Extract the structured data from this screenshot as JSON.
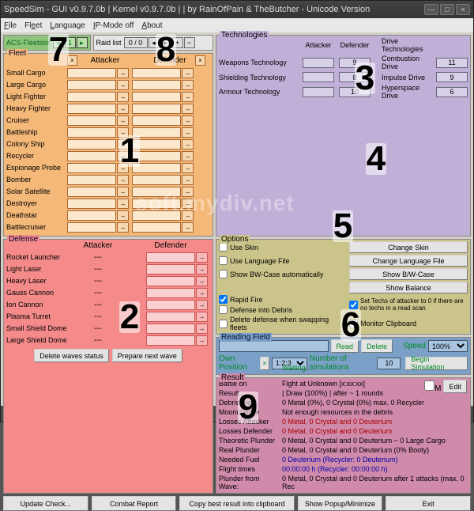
{
  "window": {
    "title": "SpeedSim - GUI v0.9.7.0b  |  Kernel v0.9.7.0b  | |  by RainOfPain & TheButcher - Unicode Version"
  },
  "menu": {
    "file": "File",
    "fleet": "Fleet",
    "language": "Language",
    "ipmode": "IP-Mode off",
    "about": "About"
  },
  "acs": {
    "label": "ACS-Fleetslot",
    "val": "1"
  },
  "raid": {
    "label": "Raid list",
    "val": "0 / 0"
  },
  "fleet": {
    "legend": "Fleet",
    "hdr_att": "Attacker",
    "hdr_def": "Defender",
    "items": [
      {
        "name": "Small Cargo"
      },
      {
        "name": "Large Cargo"
      },
      {
        "name": "Light Fighter"
      },
      {
        "name": "Heavy Fighter"
      },
      {
        "name": "Cruiser"
      },
      {
        "name": "Battleship"
      },
      {
        "name": "Colony Ship"
      },
      {
        "name": "Recycler"
      },
      {
        "name": "Espionage Probe"
      },
      {
        "name": "Bomber"
      },
      {
        "name": "Solar Satellite"
      },
      {
        "name": "Destroyer"
      },
      {
        "name": "Deathstar"
      },
      {
        "name": "Battlecruiser"
      }
    ]
  },
  "defense": {
    "legend": "Defense",
    "hdr_att": "Attacker",
    "hdr_def": "Defender",
    "items": [
      {
        "name": "Rocket Launcher"
      },
      {
        "name": "Light Laser"
      },
      {
        "name": "Heavy Laser"
      },
      {
        "name": "Gauss Cannon"
      },
      {
        "name": "Ion Cannon"
      },
      {
        "name": "Plasma Turret"
      },
      {
        "name": "Small Shield Dome"
      },
      {
        "name": "Large Shield Dome"
      }
    ],
    "btn_delete": "Delete waves status",
    "btn_prepare": "Prepare next wave"
  },
  "tech": {
    "legend": "Technologies",
    "hdr_att": "Attacker",
    "hdr_def": "Defender",
    "hdr_drive": "Drive Technologies",
    "rows": [
      {
        "name": "Weapons Technology",
        "a": "",
        "d": "9",
        "drive": "Combustion Drive",
        "dv": "11"
      },
      {
        "name": "Shielding Technology",
        "a": "",
        "d": "8",
        "drive": "Impulse Drive",
        "dv": "9"
      },
      {
        "name": "Armour Technology",
        "a": "",
        "d": "10",
        "drive": "Hyperspace Drive",
        "dv": "6"
      }
    ]
  },
  "options": {
    "legend": "Options",
    "use_skin": "Use Skin",
    "change_skin": "Change Skin",
    "use_lang": "Use Language File",
    "change_lang": "Change Language File",
    "show_bw": "Show BW-Case automatically",
    "show_bw_btn": "Show B/W-Case",
    "show_balance": "Show Balance",
    "rapid": "Rapid Fire",
    "def_debris": "Defense into Debris",
    "set_techs": "Set Techs of attacker to 0 if there are no techs in a read scan",
    "del_def": "Delete defense when swapping fleets",
    "monitor": "Monitor Clipboard"
  },
  "reading": {
    "legend": "Reading Field",
    "read": "Read",
    "delete": "Delete",
    "speed_lbl": "Speed",
    "speed_val": "100%",
    "ownpos": "Own Position",
    "pos_val": "1:2:3",
    "numsim_lbl": "Number of simulations",
    "numsim_val": "10",
    "waiting": "Waiting...",
    "begin": "Begin Simulation"
  },
  "result": {
    "legend": "Result",
    "m_lbl": "M",
    "edit": "Edit",
    "rows": [
      {
        "k": "Battle on",
        "v": "Fight at Unknown [x:xx:xx]"
      },
      {
        "k": "Result",
        "v": "| Draw (100%) | after ~ 1 rounds"
      },
      {
        "k": "Debris Field",
        "v": "0 Metal (0%), 0 Crystal (0%) max. 0 Recycler"
      },
      {
        "k": "Moonchance",
        "v": "Not enough resources in the debris"
      },
      {
        "k": "Losses Attacker",
        "v": "0 Metal, 0 Crystal and 0 Deuterium",
        "cls": "red"
      },
      {
        "k": "Losses Defender",
        "v": "0 Metal, 0 Crystal and 0 Deuterium",
        "cls": "red"
      },
      {
        "k": "Theoretic Plunder",
        "v": "0 Metal, 0 Crystal and 0 Deuterium ~ 0 Large Cargo"
      },
      {
        "k": "Real Plunder",
        "v": "0 Metal, 0 Crystal and 0 Deuterium (0% Booty)"
      },
      {
        "k": "Needed Fuel",
        "v": "0 Deuterium (Recycler: 0 Deuterium)",
        "cls": "blue"
      },
      {
        "k": "Flight times",
        "v": "00:00:00 h (Recycler: 00:00:00 h)",
        "cls": "blue"
      },
      {
        "k": "Plunder from Wave:",
        "v": "0 Metal, 0 Crystal and 0 Deuterium after 1 attacks (max. 0 Rec"
      }
    ]
  },
  "bottom": {
    "update": "Update Check...",
    "combat": "Combat Report",
    "copy": "Copy best result into clipboard",
    "popup": "Show Popup/Minimize",
    "exit": "Exit"
  },
  "overlays": {
    "1": "1",
    "2": "2",
    "3": "3",
    "4": "4",
    "5": "5",
    "6": "6",
    "7": "7",
    "8": "8",
    "9": "9"
  },
  "watermark": "soft.mydiv.net"
}
